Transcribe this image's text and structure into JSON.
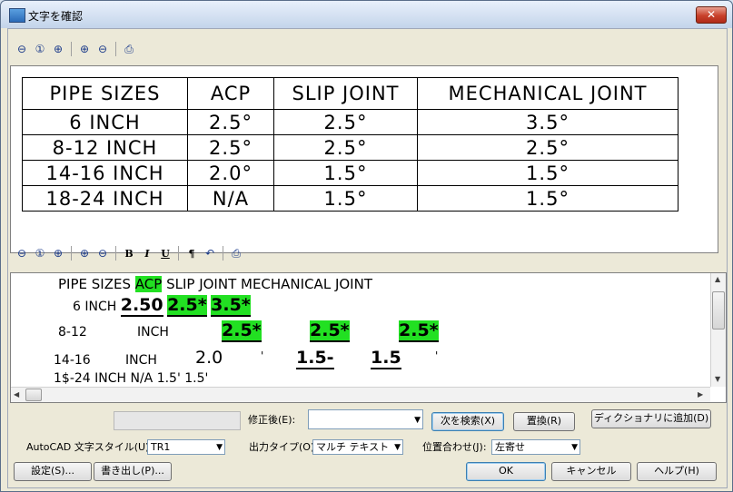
{
  "window": {
    "title": "文字を確認",
    "close_label": "✕"
  },
  "preview_table": {
    "headers": [
      "PIPE SIZES",
      "ACP",
      "SLIP JOINT",
      "MECHANICAL JOINT"
    ],
    "rows": [
      [
        "6 INCH",
        "2.5°",
        "2.5°",
        "3.5°"
      ],
      [
        "8-12 INCH",
        "2.5°",
        "2.5°",
        "2.5°"
      ],
      [
        "14-16 INCH",
        "2.0°",
        "1.5°",
        "1.5°"
      ],
      [
        "18-24 INCH",
        "N/A",
        "1.5°",
        "1.5°"
      ]
    ]
  },
  "editor": {
    "line1": {
      "a": "PIPE SIZES",
      "b": "ACP",
      "c": "SLIP JOINT MECHANICAL JOINT"
    },
    "line2": {
      "a": "6 INCH",
      "b": "2.50",
      "c": "2.5*",
      "d": "3.5*"
    },
    "line3": {
      "a": "8-12",
      "b": "INCH",
      "c": "2.5*",
      "d": "2.5*",
      "e": "2.5*"
    },
    "line4": {
      "a": "14-16",
      "b": "INCH",
      "c": "2.0",
      "d": "'",
      "e": "1.5-",
      "f": "1.5",
      "g": "'"
    },
    "line5": {
      "a": "1$-24 INCH N/A 1.5' 1.5'"
    }
  },
  "toolbar_bottom": {
    "bold": "B",
    "italic": "I",
    "underline": "U",
    "pilcrow": "¶"
  },
  "correction": {
    "label": "修正後(E):",
    "value": "",
    "find_next": "次を検索(X)",
    "replace": "置換(R)",
    "add_dict": "ディクショナリに追加(D)"
  },
  "options": {
    "style_label": "AutoCAD 文字スタイル(U):",
    "style_value": "TR1",
    "output_label": "出力タイプ(O):",
    "output_value": "マルチ テキスト",
    "align_label": "位置合わせ(J):",
    "align_value": "左寄せ"
  },
  "buttons": {
    "settings": "設定(S)...",
    "export": "書き出し(P)...",
    "ok": "OK",
    "cancel": "キャンセル",
    "help": "ヘルプ(H)"
  }
}
